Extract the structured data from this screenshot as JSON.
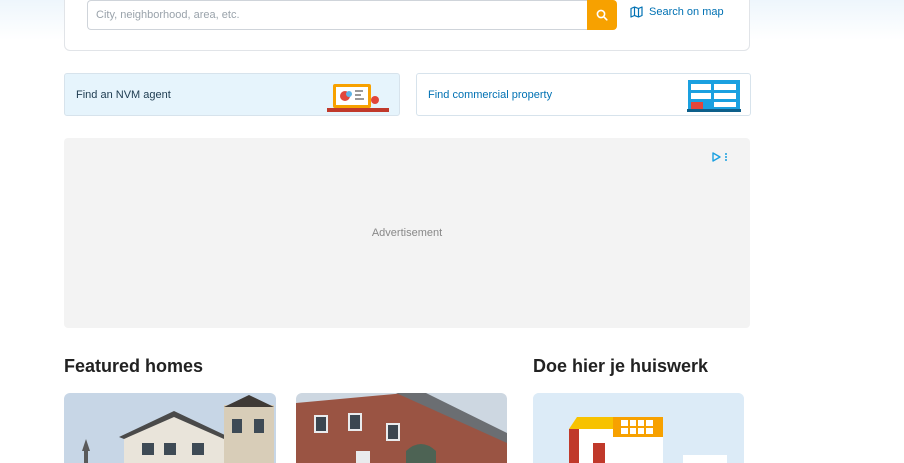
{
  "search": {
    "placeholder": "City, neighborhood, area, etc.",
    "map_link_label": "Search on map"
  },
  "promos": {
    "agent_label": "Find an NVM agent",
    "commercial_label": "Find commercial property"
  },
  "advertisement": {
    "label": "Advertisement"
  },
  "featured": {
    "title": "Featured homes"
  },
  "homework": {
    "title": "Doe hier je huiswerk"
  },
  "colors": {
    "accent_orange": "#f7a100",
    "link_blue": "#0071b3"
  }
}
